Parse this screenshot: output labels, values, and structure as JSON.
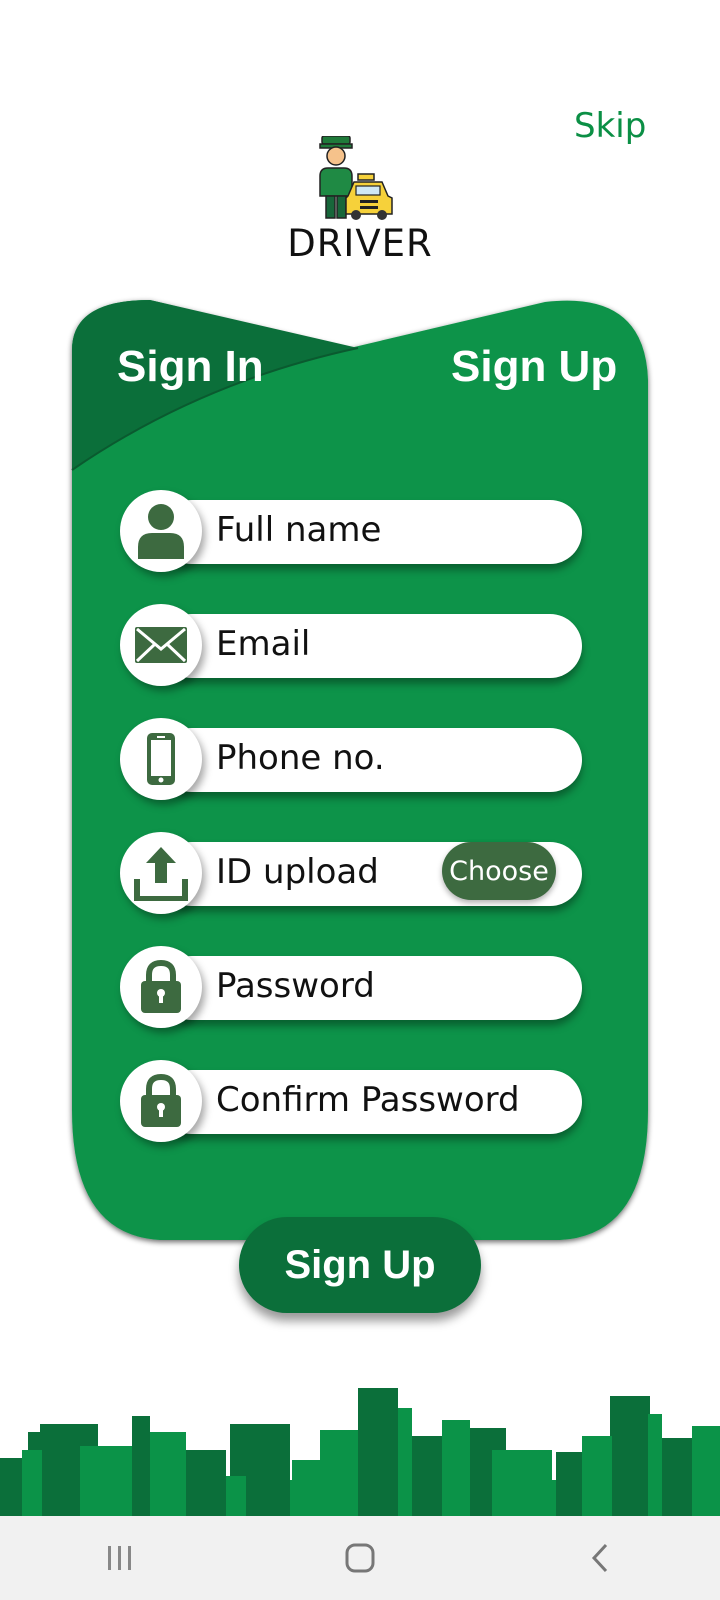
{
  "header": {
    "skip_label": "Skip",
    "app_title": "DRIVER",
    "logo_icon": "driver-taxi-icon"
  },
  "tabs": {
    "sign_in": "Sign In",
    "sign_up": "Sign Up"
  },
  "form": {
    "fields": [
      {
        "label": "Full name",
        "icon": "person-icon"
      },
      {
        "label": "Email",
        "icon": "envelope-icon"
      },
      {
        "label": "Phone no.",
        "icon": "phone-icon"
      },
      {
        "label": "ID upload",
        "icon": "upload-icon",
        "button": "Choose"
      },
      {
        "label": "Password",
        "icon": "lock-icon"
      },
      {
        "label": "Confirm Password",
        "icon": "lock-icon"
      }
    ],
    "submit_label": "Sign Up"
  },
  "colors": {
    "brand_green": "#0b9348",
    "dark_green": "#0b6f3a",
    "icon_green": "#3d6a40",
    "skip_green": "#0b8f45"
  },
  "navbar": {
    "items": [
      "recents-icon",
      "home-icon",
      "back-icon"
    ]
  }
}
